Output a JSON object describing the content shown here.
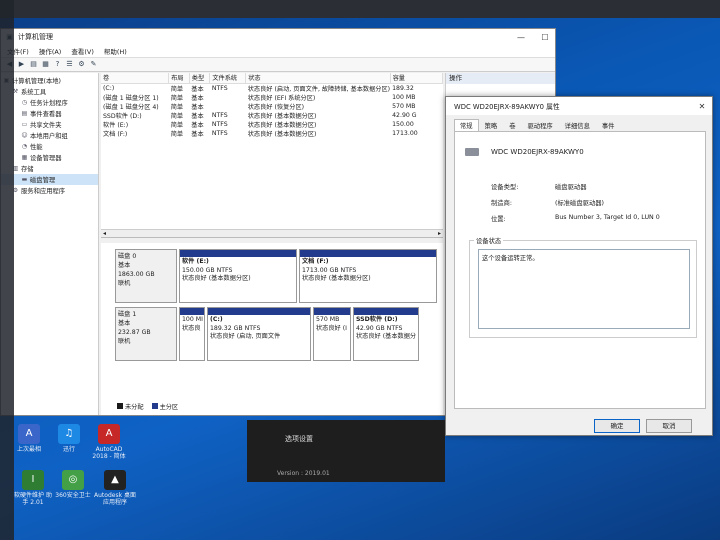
{
  "window": {
    "title": "计算机管理",
    "menu": [
      "文件(F)",
      "操作(A)",
      "查看(V)",
      "帮助(H)"
    ],
    "actions_header": "操作"
  },
  "tree": [
    {
      "label": "计算机管理(本地)",
      "icon": "computer-icon",
      "indent": 0
    },
    {
      "label": "系统工具",
      "icon": "tools-icon",
      "indent": 1
    },
    {
      "label": "任务计划程序",
      "icon": "clock-icon",
      "indent": 2
    },
    {
      "label": "事件查看器",
      "icon": "event-icon",
      "indent": 2
    },
    {
      "label": "共享文件夹",
      "icon": "folder-icon",
      "indent": 2
    },
    {
      "label": "本地用户和组",
      "icon": "users-icon",
      "indent": 2
    },
    {
      "label": "性能",
      "icon": "chart-icon",
      "indent": 2
    },
    {
      "label": "设备管理器",
      "icon": "device-icon",
      "indent": 2
    },
    {
      "label": "存储",
      "icon": "storage-icon",
      "indent": 1
    },
    {
      "label": "磁盘管理",
      "icon": "disk-icon",
      "indent": 2
    },
    {
      "label": "服务和应用程序",
      "icon": "services-icon",
      "indent": 1
    }
  ],
  "volumes": {
    "headers": [
      "卷",
      "布局",
      "类型",
      "文件系统",
      "状态",
      "容量"
    ],
    "rows": [
      [
        "(C:)",
        "简单",
        "基本",
        "NTFS",
        "状态良好 (启动, 页面文件, 故障转储, 基本数据分区)",
        "189.32"
      ],
      [
        "(磁盘 1 磁盘分区 1)",
        "简单",
        "基本",
        "",
        "状态良好 (EFI 系统分区)",
        "100 MB"
      ],
      [
        "(磁盘 1 磁盘分区 4)",
        "简单",
        "基本",
        "",
        "状态良好 (恢复分区)",
        "570 MB"
      ],
      [
        "SSD软件 (D:)",
        "简单",
        "基本",
        "NTFS",
        "状态良好 (基本数据分区)",
        "42.90 G"
      ],
      [
        "软件 (E:)",
        "简单",
        "基本",
        "NTFS",
        "状态良好 (基本数据分区)",
        "150.00"
      ],
      [
        "文档 (F:)",
        "简单",
        "基本",
        "NTFS",
        "状态良好 (基本数据分区)",
        "1713.00"
      ]
    ]
  },
  "disks": [
    {
      "name": "磁盘 0",
      "type": "基本",
      "size": "1863.00 GB",
      "state": "联机",
      "parts": [
        {
          "name": "软件 (E:)",
          "size": "150.00 GB NTFS",
          "status": "状态良好 (基本数据分区)"
        },
        {
          "name": "文档 (F:)",
          "size": "1713.00 GB NTFS",
          "status": "状态良好 (基本数据分区)"
        }
      ]
    },
    {
      "name": "磁盘 1",
      "type": "基本",
      "size": "232.87 GB",
      "state": "联机",
      "parts": [
        {
          "name": "",
          "size": "100 MI",
          "status": "状态良"
        },
        {
          "name": "(C:)",
          "size": "189.32 GB NTFS",
          "status": "状态良好 (启动, 页面文件"
        },
        {
          "name": "",
          "size": "570 MB",
          "status": "状态良好 (I"
        },
        {
          "name": "SSD软件 (D:)",
          "size": "42.90 GB NTFS",
          "status": "状态良好 (基本数据分"
        }
      ]
    }
  ],
  "legend": [
    {
      "label": "未分配",
      "color": "#1a1a1a"
    },
    {
      "label": "主分区",
      "color": "#233b8c"
    }
  ],
  "dialog": {
    "title": "WDC WD20EJRX-89AKWY0 属性",
    "tabs": [
      "常规",
      "策略",
      "卷",
      "驱动程序",
      "详细信息",
      "事件"
    ],
    "device_name": "WDC WD20EJRX-89AKWY0",
    "props": [
      {
        "label": "设备类型:",
        "value": "磁盘驱动器"
      },
      {
        "label": "制造商:",
        "value": "(标准磁盘驱动器)"
      },
      {
        "label": "位置:",
        "value": "Bus Number 3, Target Id 0, LUN 0"
      }
    ],
    "status_group": "设备状态",
    "status_text": "这个设备运转正常。",
    "ok": "确定",
    "cancel": "取消"
  },
  "popup": {
    "line1": "选项设置",
    "line2": "Version : 2019.01"
  },
  "desktop_icons": [
    {
      "label": "上次最相",
      "icon": "A",
      "color": "#3a66c9"
    },
    {
      "label": "迅行",
      "icon": "♫",
      "color": "#1e88e5"
    },
    {
      "label": "AutoCAD 2018 - 简体",
      "icon": "A",
      "color": "#c62828"
    },
    {
      "label": "软硬件维护 助手 2.01",
      "icon": "I",
      "color": "#2e7d32"
    },
    {
      "label": "360安全卫士",
      "icon": "◎",
      "color": "#43a047"
    },
    {
      "label": "Autodesk 桌面应用程序",
      "icon": "▲",
      "color": "#222"
    }
  ],
  "colors": {
    "primary_partition": "#233b8c",
    "desktop": "#0a58b5",
    "selected": "#cde3f7"
  }
}
